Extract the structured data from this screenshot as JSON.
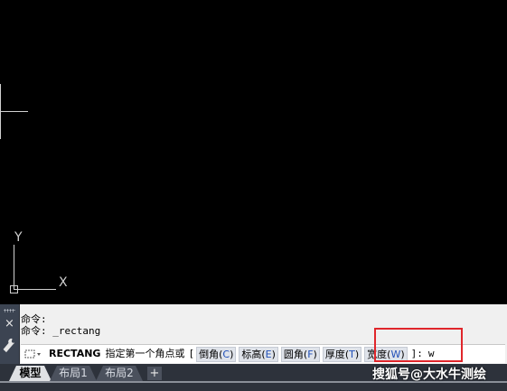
{
  "canvas": {
    "background": "#000000",
    "axis_y_label": "Y",
    "axis_x_label": "X"
  },
  "palette": {
    "close_symbol": "×",
    "history": [
      "命令:",
      "命令: _rectang"
    ],
    "command": {
      "keyword": "RECTANG",
      "prompt": "指定第一个角点或",
      "bracket_open": "[",
      "options": [
        {
          "label": "倒角(",
          "key": "C",
          "close": ")"
        },
        {
          "label": "标高(",
          "key": "E",
          "close": ")"
        },
        {
          "label": "圆角(",
          "key": "F",
          "close": ")"
        },
        {
          "label": "厚度(",
          "key": "T",
          "close": ")"
        },
        {
          "label": "宽度(",
          "key": "W",
          "close": ")"
        }
      ],
      "bracket_close": "]:",
      "typed": "w"
    },
    "highlight_color": "#e0262b"
  },
  "tabs": {
    "model": "模型",
    "layout1": "布局1",
    "layout2": "布局2",
    "add": "+"
  },
  "watermark": "搜狐号@大水牛测绘"
}
